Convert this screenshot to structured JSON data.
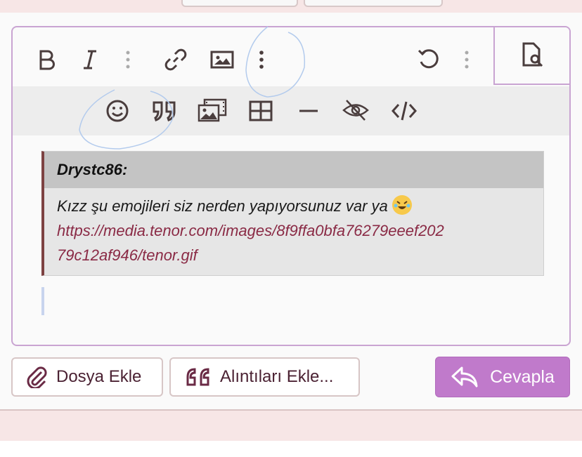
{
  "editor": {
    "quote": {
      "author": "Drystc86:",
      "text": "Kızz şu emojileri siz nerden yapıyorsunuz var ya",
      "emoji": "rolling-on-floor-laughing",
      "link_line1": "https://media.tenor.com/images/8f9ffa0bfa76279eeef202",
      "link_line2": "79c12af946/tenor.gif"
    }
  },
  "toolbar": {
    "row1": [
      "bold-icon",
      "italic-icon",
      "more-vertical-icon",
      "link-icon",
      "image-icon",
      "more-vertical-icon",
      "undo-icon",
      "more-vertical-icon",
      "preview-icon"
    ],
    "row2": [
      "emoji-icon",
      "quote-icon",
      "media-icon",
      "table-icon",
      "horizontal-rule-icon",
      "hide-icon",
      "code-icon"
    ]
  },
  "actions": {
    "attach_label": "Dosya Ekle",
    "quotes_label": "Alıntıları Ekle...",
    "reply_label": "Cevapla"
  },
  "colors": {
    "accent": "#c07acb",
    "quote_border": "#7d4242",
    "link": "#8a2a45",
    "editor_border": "#c9a4d2"
  }
}
